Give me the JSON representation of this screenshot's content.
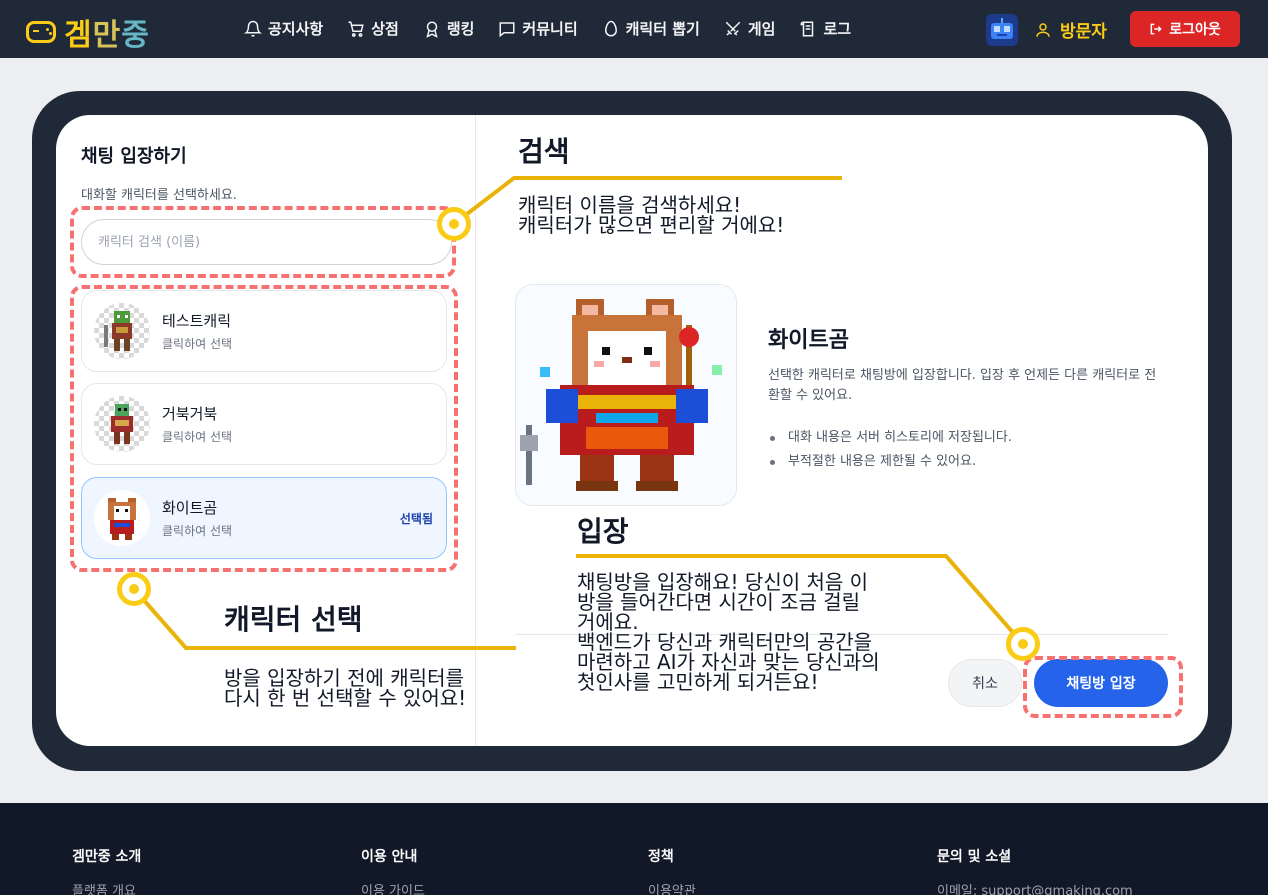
{
  "header": {
    "logo_text_1": "겜",
    "logo_text_2": "만",
    "logo_text_3": "중",
    "nav": [
      {
        "label": "공지사항",
        "icon": "bell-icon"
      },
      {
        "label": "상점",
        "icon": "cart-icon"
      },
      {
        "label": "랭킹",
        "icon": "medal-icon"
      },
      {
        "label": "커뮤니티",
        "icon": "chat-icon"
      },
      {
        "label": "캐릭터 뽑기",
        "icon": "egg-icon"
      },
      {
        "label": "게임",
        "icon": "swords-icon"
      },
      {
        "label": "로그",
        "icon": "log-icon"
      }
    ],
    "visitor": "방문자",
    "logout": "로그아웃"
  },
  "left": {
    "title": "채팅 입장하기",
    "subtitle": "대화할 캐릭터를 선택하세요.",
    "search_placeholder": "캐릭터 검색 (이름)",
    "hint": "클릭하여 선택",
    "selected_badge": "선택됨",
    "characters": [
      {
        "name": "테스트캐릭",
        "selected": false
      },
      {
        "name": "거북거북",
        "selected": false
      },
      {
        "name": "화이트곰",
        "selected": true
      }
    ]
  },
  "right": {
    "character_name": "화이트곰",
    "description": "선택한 캐릭터로 채팅방에 입장합니다. 입장 후 언제든 다른 캐릭터로 전환할 수 있어요.",
    "bullets": [
      "대화 내용은 서버 히스토리에 저장됩니다.",
      "부적절한 내용은 제한될 수 있어요."
    ],
    "cancel": "취소",
    "enter": "채팅방 입장"
  },
  "annotations": {
    "search_title": "검색",
    "search_text": "캐릭터 이름을 검색하세요!\n캐릭터가 많으면 편리할 거에요!",
    "enter_title": "입장",
    "enter_text": "채팅방을 입장해요! 당신이 처음 이\n방을 들어간다면 시간이 조금 걸릴\n거에요.\n백엔드가 당신과 캐릭터만의 공간을\n마련하고 AI가 자신과 맞는 당신과의\n첫인사를 고민하게 되거든요!",
    "select_title": "캐릭터 선택",
    "select_text": "방을 입장하기 전에 캐릭터를\n다시 한 번 선택할 수 있어요!"
  },
  "footer": {
    "cols": [
      {
        "head": "겜만중 소개",
        "link": "플랫폼 개요"
      },
      {
        "head": "이용 안내",
        "link": "이용 가이드"
      },
      {
        "head": "정책",
        "link": "이용약관"
      },
      {
        "head": "문의 및 소셜",
        "link": "이메일: support@gmaking.com"
      }
    ]
  },
  "colors": {
    "header_bg": "#1f2937",
    "accent_yellow": "#facc15",
    "primary_blue": "#2563eb",
    "logout_red": "#dc2626",
    "annotation_dash": "#f87171"
  }
}
